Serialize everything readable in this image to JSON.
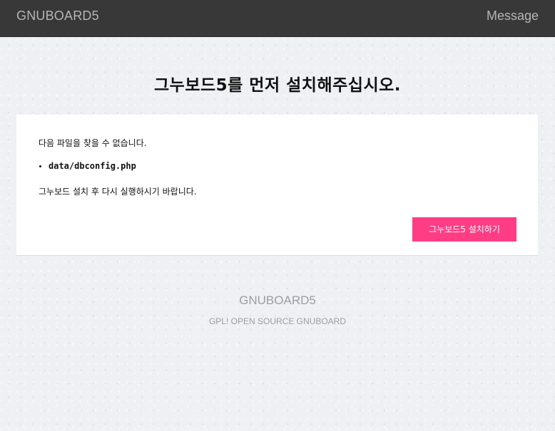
{
  "header": {
    "brand": "GNUBOARD5",
    "right_label": "Message"
  },
  "main": {
    "headline": "그누보드5를 먼저 설치해주십시오.",
    "message_missing": "다음 파일을 찾을 수 없습니다.",
    "missing_files": [
      "data/dbconfig.php"
    ],
    "message_instruction": "그누보드 설치 후 다시 실행하시기 바랍니다.",
    "install_button_label": "그누보드5 설치하기"
  },
  "footer": {
    "title": "GNUBOARD5",
    "subtitle": "GPL! OPEN SOURCE GNUBOARD"
  },
  "colors": {
    "topbar_bg": "#383838",
    "page_bg": "#eef0f3",
    "accent_button": "#ff3d84",
    "muted_text": "#9a9ea4"
  }
}
